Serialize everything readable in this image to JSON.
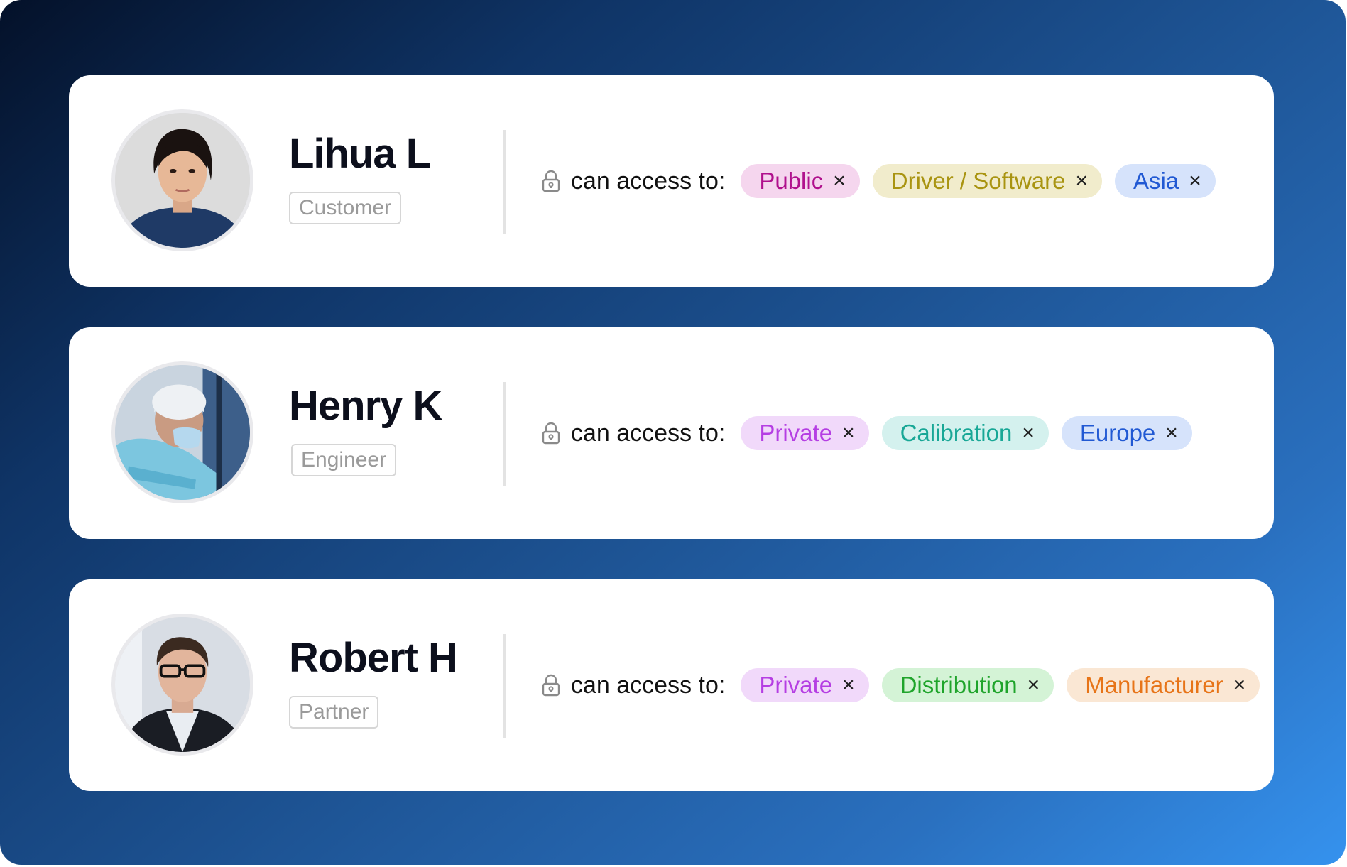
{
  "users": [
    {
      "name": "Lihua L",
      "role": "Customer",
      "access_label": "can access to:",
      "tags": [
        {
          "label": "Public",
          "bg": "#f5d6ee",
          "fg": "#b0118d"
        },
        {
          "label": "Driver / Software",
          "bg": "#f1eccc",
          "fg": "#a99411"
        },
        {
          "label": "Asia",
          "bg": "#d6e3fb",
          "fg": "#2159d3"
        }
      ]
    },
    {
      "name": "Henry K",
      "role": "Engineer",
      "access_label": "can access to:",
      "tags": [
        {
          "label": "Private",
          "bg": "#f1d9fa",
          "fg": "#b53ee3"
        },
        {
          "label": "Calibration",
          "bg": "#d4f1ee",
          "fg": "#18a796"
        },
        {
          "label": "Europe",
          "bg": "#d6e3fb",
          "fg": "#2159d3"
        }
      ]
    },
    {
      "name": "Robert H",
      "role": "Partner",
      "access_label": "can access to:",
      "tags": [
        {
          "label": "Private",
          "bg": "#f1d9fa",
          "fg": "#b53ee3"
        },
        {
          "label": "Distribution",
          "bg": "#d4f3d6",
          "fg": "#1fa42b"
        },
        {
          "label": "Manufacturer",
          "bg": "#fae7d4",
          "fg": "#e77418"
        }
      ]
    }
  ],
  "remove_symbol": "×"
}
